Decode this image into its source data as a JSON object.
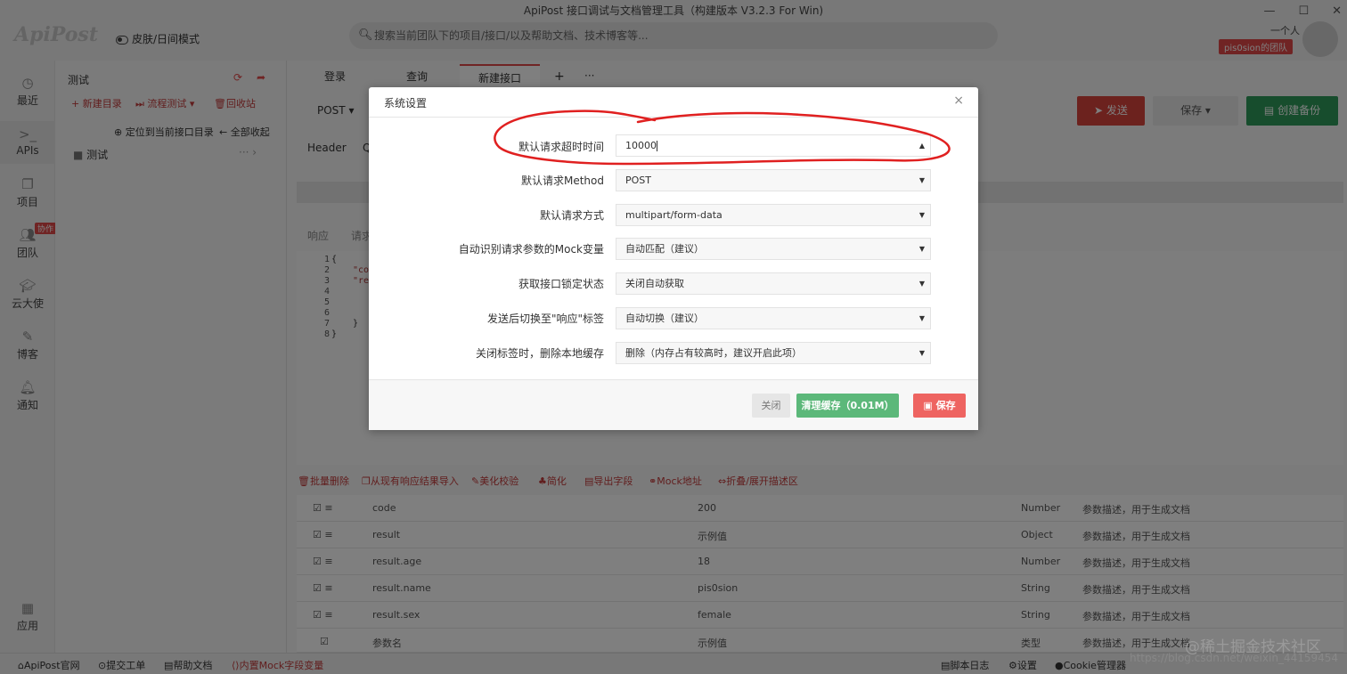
{
  "window": {
    "title": "ApiPost 接口调试与文档管理工具（构建版本 V3.2.3 For Win)"
  },
  "header": {
    "logo": "ApiPost",
    "skin_toggle": "皮肤/日间模式",
    "search_placeholder": "搜索当前团队下的项目/接口/以及帮助文档、技术博客等...",
    "user": "一个人",
    "team": "pis0sion的团队"
  },
  "leftnav": {
    "items": [
      {
        "label": "最近",
        "icon": "clock-icon"
      },
      {
        "label": "APIs",
        "icon": "terminal-icon"
      },
      {
        "label": "项目",
        "icon": "project-icon"
      },
      {
        "label": "团队",
        "icon": "team-icon",
        "badge": "协作"
      },
      {
        "label": "云大使",
        "icon": "graduation-cap-icon"
      },
      {
        "label": "博客",
        "icon": "edit-icon"
      },
      {
        "label": "通知",
        "icon": "bell-icon"
      },
      {
        "label": "应用",
        "icon": "apps-icon"
      }
    ]
  },
  "tree": {
    "title": "测试",
    "new_dir": "新建目录",
    "flow_test": "流程测试",
    "recycle": "回收站",
    "locate": "定位到当前接口目录",
    "collapse_all": "全部收起",
    "folder": "测试"
  },
  "tabs": [
    "登录",
    "查询",
    "新建接口"
  ],
  "request": {
    "method": "POST",
    "send": "发送",
    "save": "保存",
    "backup": "创建备份",
    "header_tab": "Header",
    "q_tab": "Q",
    "resp_tab": "响应",
    "req_tab": "请求"
  },
  "code": {
    "lines": [
      "1",
      "2",
      "3",
      "4",
      "5",
      "6",
      "7",
      "8"
    ],
    "text": [
      "{",
      "\"cod",
      "\"res",
      "",
      "",
      "",
      "}",
      "}"
    ]
  },
  "toolbar": [
    "批量删除",
    "从现有响应结果导入",
    "美化校验",
    "简化",
    "导出字段",
    "Mock地址",
    "折叠/展开描述区"
  ],
  "table": {
    "rows": [
      {
        "name": "code",
        "value": "200",
        "type": "Number",
        "desc": "参数描述，用于生成文档"
      },
      {
        "name": "result",
        "value": "示例值",
        "type": "Object",
        "desc": "参数描述，用于生成文档"
      },
      {
        "name": "result.age",
        "value": "18",
        "type": "Number",
        "desc": "参数描述，用于生成文档"
      },
      {
        "name": "result.name",
        "value": "pis0sion",
        "type": "String",
        "desc": "参数描述，用于生成文档"
      },
      {
        "name": "result.sex",
        "value": "female",
        "type": "String",
        "desc": "参数描述，用于生成文档"
      },
      {
        "name": "参数名",
        "value": "示例值",
        "type": "类型",
        "desc": "参数描述，用于生成文档"
      }
    ]
  },
  "statusbar": {
    "site": "ApiPost官网",
    "ticket": "提交工单",
    "help": "帮助文档",
    "mock": "内置Mock字段变量",
    "log": "脚本日志",
    "settings": "设置",
    "cookie": "Cookie管理器"
  },
  "modal": {
    "title": "系统设置",
    "fields": [
      {
        "label": "默认请求超时时间",
        "value": "10000"
      },
      {
        "label": "默认请求Method",
        "value": "POST"
      },
      {
        "label": "默认请求方式",
        "value": "multipart/form-data"
      },
      {
        "label": "自动识别请求参数的Mock变量",
        "value": "自动匹配（建议）"
      },
      {
        "label": "获取接口锁定状态",
        "value": "关闭自动获取"
      },
      {
        "label": "发送后切换至\"响应\"标签",
        "value": "自动切换（建议）"
      },
      {
        "label": "关闭标签时，删除本地缓存",
        "value": "删除（内存占有较高时，建议开启此项）"
      }
    ],
    "close": "关闭",
    "clear_cache": "清理缓存（0.01M）",
    "save": "保存"
  },
  "watermark": {
    "line1": "@稀土掘金技术社区",
    "line2": "https://blog.csdn.net/weixin_44159454"
  },
  "colors": {
    "send": "#d9453d",
    "backup": "#2f9a5a",
    "clear": "#5cb87a",
    "save": "#ee6461",
    "annotation": "#e02020"
  }
}
